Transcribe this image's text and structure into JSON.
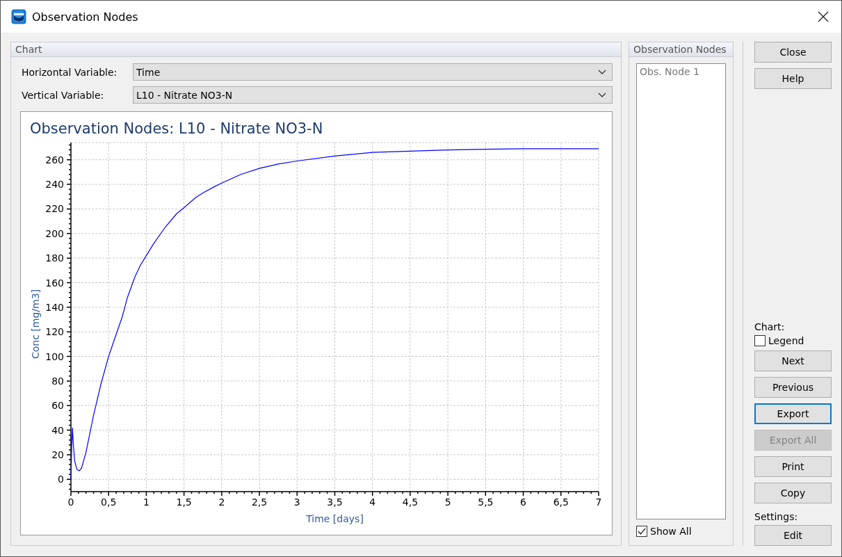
{
  "window": {
    "title": "Observation Nodes"
  },
  "chart_group": {
    "title": "Chart",
    "fields": [
      {
        "label": "Horizontal Variable:",
        "value": "Time"
      },
      {
        "label": "Vertical Variable:",
        "value": "L10 - Nitrate NO3-N"
      }
    ],
    "chart_data": {
      "type": "line",
      "title": "Observation Nodes: L10 - Nitrate NO3-N",
      "xlabel": "Time [days]",
      "ylabel": "Conc [mg/m3]",
      "x": [
        0,
        0.01,
        0.02,
        0.03,
        0.05,
        0.08,
        0.11,
        0.14,
        0.2,
        0.3,
        0.4,
        0.5,
        0.6,
        0.68,
        0.75,
        0.85,
        0.92,
        1,
        1.1,
        1.25,
        1.4,
        1.5,
        1.65,
        1.75,
        1.9,
        2,
        2.25,
        2.5,
        2.75,
        3,
        3.5,
        4,
        4.5,
        5,
        5.5,
        6,
        6.5,
        7
      ],
      "series": [
        {
          "color": "#0000ff",
          "values": [
            0,
            25,
            42,
            30,
            15,
            8,
            7,
            9,
            22,
            52,
            78,
            100,
            118,
            132,
            148,
            165,
            174,
            182,
            192,
            205,
            216,
            221,
            229,
            233,
            238,
            241,
            248,
            253,
            256.5,
            259,
            263,
            266,
            267,
            268,
            268.5,
            269,
            269,
            269
          ]
        }
      ],
      "grid": true,
      "xlim": [
        0,
        7
      ],
      "ylim": [
        -10,
        274
      ],
      "xticks": [
        0,
        {
          "value": 0.5,
          "label": "0,5"
        },
        1,
        {
          "value": 1.5,
          "label": "1,5"
        },
        2,
        {
          "value": 2.5,
          "label": "2,5"
        },
        3,
        {
          "value": 3.5,
          "label": "3,5"
        },
        4,
        {
          "value": 4.5,
          "label": "4,5"
        },
        5,
        {
          "value": 5.5,
          "label": "5,5"
        },
        6,
        {
          "value": 6.5,
          "label": "6,5"
        },
        7
      ],
      "yticks": [
        0,
        20,
        40,
        60,
        80,
        100,
        120,
        140,
        160,
        180,
        200,
        220,
        240,
        260
      ]
    }
  },
  "nodes_group": {
    "title": "Observation Nodes",
    "items": [
      {
        "label": "Obs. Node 1",
        "selected": false
      }
    ],
    "show_all": {
      "label": "Show All",
      "checked": true
    }
  },
  "side": {
    "chart_label": "Chart:",
    "settings_label": "Settings:",
    "legend": {
      "label": "Legend",
      "checked": false
    },
    "top_buttons": [
      {
        "label": "Close",
        "disabled": false,
        "focused": false
      },
      {
        "label": "Help",
        "disabled": false,
        "focused": false
      }
    ],
    "chart_buttons": [
      {
        "label": "Next",
        "disabled": false,
        "focused": false
      },
      {
        "label": "Previous",
        "disabled": false,
        "focused": false
      },
      {
        "label": "Export",
        "disabled": false,
        "focused": true
      },
      {
        "label": "Export All",
        "disabled": true,
        "focused": false
      },
      {
        "label": "Print",
        "disabled": false,
        "focused": false
      },
      {
        "label": "Copy",
        "disabled": false,
        "focused": false
      }
    ],
    "settings_buttons": [
      {
        "label": "Edit",
        "disabled": false,
        "focused": false
      }
    ]
  }
}
